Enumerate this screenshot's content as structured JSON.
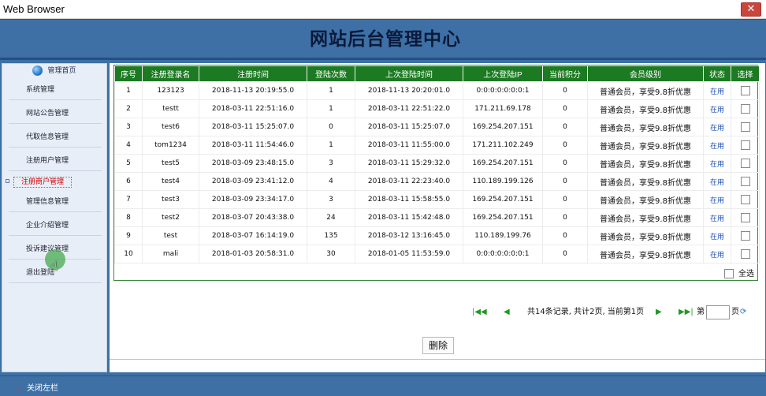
{
  "window": {
    "title": "Web Browser",
    "close_glyph": "✕"
  },
  "header": {
    "title": "网站后台管理中心"
  },
  "sidebar": {
    "head_label": "管理首页",
    "head_icon": "globe-icon",
    "items": [
      {
        "label": "系统管理"
      },
      {
        "label": "网站公告管理"
      },
      {
        "label": "代取信息管理"
      },
      {
        "label": "注册用户管理"
      },
      {
        "label": "注册商户管理"
      },
      {
        "label": "管理信息管理"
      },
      {
        "label": "企业介绍管理"
      },
      {
        "label": "投诉建议管理"
      },
      {
        "label": "退出登陆"
      }
    ]
  },
  "table": {
    "headers": [
      "序号",
      "注册登录名",
      "注册时间",
      "登陆次数",
      "上次登陆时间",
      "上次登陆IP",
      "当前积分",
      "会员级别",
      "状态",
      "选择"
    ],
    "rows": [
      {
        "no": "1",
        "name": "123123",
        "reg_time": "2018-11-13 20:19:55.0",
        "count": "1",
        "last_time": "2018-11-13 20:20:01.0",
        "ip": "0:0:0:0:0:0:0:1",
        "points": "0",
        "level": "普通会员，享受9.8折优惠",
        "status": "在用"
      },
      {
        "no": "2",
        "name": "testt",
        "reg_time": "2018-03-11 22:51:16.0",
        "count": "1",
        "last_time": "2018-03-11 22:51:22.0",
        "ip": "171.211.69.178",
        "points": "0",
        "level": "普通会员，享受9.8折优惠",
        "status": "在用"
      },
      {
        "no": "3",
        "name": "test6",
        "reg_time": "2018-03-11 15:25:07.0",
        "count": "0",
        "last_time": "2018-03-11 15:25:07.0",
        "ip": "169.254.207.151",
        "points": "0",
        "level": "普通会员，享受9.8折优惠",
        "status": "在用"
      },
      {
        "no": "4",
        "name": "tom1234",
        "reg_time": "2018-03-11 11:54:46.0",
        "count": "1",
        "last_time": "2018-03-11 11:55:00.0",
        "ip": "171.211.102.249",
        "points": "0",
        "level": "普通会员，享受9.8折优惠",
        "status": "在用"
      },
      {
        "no": "5",
        "name": "test5",
        "reg_time": "2018-03-09 23:48:15.0",
        "count": "3",
        "last_time": "2018-03-11 15:29:32.0",
        "ip": "169.254.207.151",
        "points": "0",
        "level": "普通会员，享受9.8折优惠",
        "status": "在用"
      },
      {
        "no": "6",
        "name": "test4",
        "reg_time": "2018-03-09 23:41:12.0",
        "count": "4",
        "last_time": "2018-03-11 22:23:40.0",
        "ip": "110.189.199.126",
        "points": "0",
        "level": "普通会员，享受9.8折优惠",
        "status": "在用"
      },
      {
        "no": "7",
        "name": "test3",
        "reg_time": "2018-03-09 23:34:17.0",
        "count": "3",
        "last_time": "2018-03-11 15:58:55.0",
        "ip": "169.254.207.151",
        "points": "0",
        "level": "普通会员，享受9.8折优惠",
        "status": "在用"
      },
      {
        "no": "8",
        "name": "test2",
        "reg_time": "2018-03-07 20:43:38.0",
        "count": "24",
        "last_time": "2018-03-11 15:42:48.0",
        "ip": "169.254.207.151",
        "points": "0",
        "level": "普通会员，享受9.8折优惠",
        "status": "在用"
      },
      {
        "no": "9",
        "name": "test",
        "reg_time": "2018-03-07 16:14:19.0",
        "count": "135",
        "last_time": "2018-03-12 13:16:45.0",
        "ip": "110.189.199.76",
        "points": "0",
        "level": "普通会员，享受9.8折优惠",
        "status": "在用"
      },
      {
        "no": "10",
        "name": "mali",
        "reg_time": "2018-01-03 20:58:31.0",
        "count": "30",
        "last_time": "2018-01-05 11:53:59.0",
        "ip": "0:0:0:0:0:0:0:1",
        "points": "0",
        "level": "普通会员，享受9.8折优惠",
        "status": "在用"
      }
    ],
    "select_all_label": "全选"
  },
  "pager": {
    "first_icon": "first-page-icon",
    "prev_icon": "prev-page-icon",
    "summary": "共14条记录, 共计2页, 当前第1页",
    "next_icon": "next-page-icon",
    "last_icon": "last-page-icon",
    "go_prefix": "第",
    "go_suffix": "页",
    "go_icon": "go-refresh-icon"
  },
  "actions": {
    "delete_label": "删除"
  },
  "footer": {
    "close_left_label": "关闭左栏"
  },
  "colors": {
    "brand_blue": "#3e70a5",
    "table_header_green": "#1c7a22",
    "status_link_blue": "#1d4fb8",
    "active_menu_red": "#cc0000",
    "close_button_red": "#c9463d"
  }
}
